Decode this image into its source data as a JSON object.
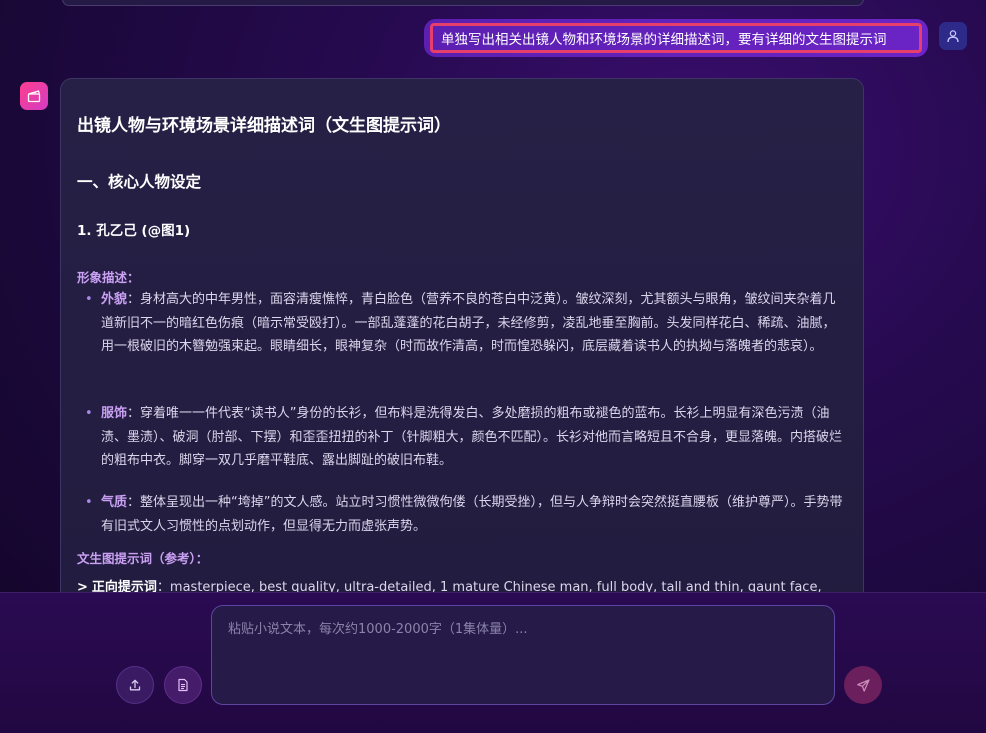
{
  "user_message": "单独写出相关出镜人物和环境场景的详细描述词，要有详细的文生图提示词",
  "response": {
    "title": "出镜人物与环境场景详细描述词（文生图提示词）",
    "section": "一、核心人物设定",
    "character": "1. 孔乙己 (@图1)",
    "appearance_label": "形象描述：",
    "bullets": [
      {
        "key": "外貌",
        "text": "：身材高大的中年男性，面容清瘦憔悴，青白脸色（营养不良的苍白中泛黄）。皱纹深刻，尤其额头与眼角，皱纹间夹杂着几道新旧不一的暗红色伤痕（暗示常受殴打）。一部乱蓬蓬的花白胡子，未经修剪，凌乱地垂至胸前。头发同样花白、稀疏、油腻，用一根破旧的木簪勉强束起。眼睛细长，眼神复杂（时而故作清高，时而惶恐躲闪，底层藏着读书人的执拗与落魄者的悲哀）。"
      },
      {
        "key": "服饰",
        "text": "：穿着唯一一件代表“读书人”身份的长衫，但布料是洗得发白、多处磨损的粗布或褪色的蓝布。长衫上明显有深色污渍（油渍、墨渍）、破洞（肘部、下摆）和歪歪扭扭的补丁（针脚粗大，颜色不匹配）。长衫对他而言略短且不合身，更显落魄。内搭破烂的粗布中衣。脚穿一双几乎磨平鞋底、露出脚趾的破旧布鞋。"
      },
      {
        "key": "气质",
        "text": "：整体呈现出一种“垮掉”的文人感。站立时习惯性微微佝偻（长期受挫），但与人争辩时会突然挺直腰板（维护尊严）。手势带有旧式文人习惯性的点划动作，但显得无力而虚张声势。"
      }
    ],
    "prompt_label": "文生图提示词（参考）：",
    "prompt_gt": ">",
    "prompt_key": "正向提示词",
    "prompt_text": "：masterpiece, best quality, ultra-detailed, 1 mature Chinese man, full body, tall and thin, gaunt face,"
  },
  "input": {
    "placeholder": "粘贴小说文本，每次约1000-2000字（1集体量）..."
  },
  "colors": {
    "user_bubble": "#6b24c6",
    "highlight_border": "#e83e6c",
    "accent_label": "#c9a0f2",
    "ai_avatar": "#ff3f8e"
  },
  "icons": [
    "user-icon",
    "clapperboard-icon",
    "upload-icon",
    "document-icon",
    "send-icon"
  ]
}
